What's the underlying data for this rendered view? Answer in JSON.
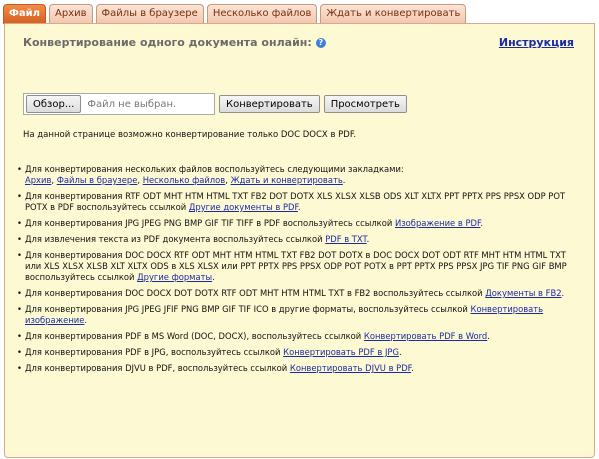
{
  "tabs": [
    "Файл",
    "Архив",
    "Файлы в браузере",
    "Несколько файлов",
    "Ждать и конвертировать"
  ],
  "header": {
    "title": "Конвертирование одного документа онлайн:",
    "help_icon": "?",
    "instruction_link": "Инструкция"
  },
  "file_input": {
    "browse_label": "Обзор...",
    "status": "Файл не выбран."
  },
  "buttons": {
    "convert": "Конвертировать",
    "view": "Просмотреть"
  },
  "note": "На данной странице возможно конвертирование только DOC DOCX в PDF.",
  "list": {
    "item1": {
      "text": "Для конвертирования нескольких файлов воспользуйтесь следующими закладками:",
      "links": [
        "Архив",
        "Файлы в браузере",
        "Несколько файлов",
        "Ждать и конвертировать"
      ],
      "sep": ", ",
      "end": "."
    },
    "item2": {
      "text": "Для конвертирования RTF ODT MHT HTM HTML TXT FB2 DOT DOTX XLS XLSX XLSB ODS XLT XLTX PPT PPTX PPS PPSX ODP POT POTX в PDF воспользуйтесь ссылкой ",
      "link": "Другие документы в PDF",
      "end": "."
    },
    "item3": {
      "text": "Для конвертирования JPG JPEG PNG BMP GIF TIF TIFF в PDF воспользуйтесь ссылкой ",
      "link": "Изображение в PDF",
      "end": "."
    },
    "item4": {
      "text": "Для извлечения текста из PDF документа воспользуйтесь ссылкой ",
      "link": "PDF в TXT",
      "end": "."
    },
    "item5": {
      "text": "Для конвертирования DOC DOCX RTF ODT MHT HTM HTML TXT FB2 DOT DOTX в DOC DOCX DOT ODT RTF MHT HTM HTML TXT или XLS XLSX XLSB XLT XLTX ODS в XLS XLSX или PPT PPTX PPS PPSX ODP POT POTX в PPT PPTX PPS PPSX JPG TIF PNG GIF BMP воспользуйтесь ссылкой ",
      "link": "Другие форматы",
      "end": "."
    },
    "item6": {
      "text": "Для конвертирования DOC DOCX DOT DOTX RTF ODT MHT HTM HTML TXT в FB2 воспользуйтесь ссылкой ",
      "link": "Документы в FB2",
      "end": "."
    },
    "item7": {
      "text": "Для конвертирования JPG JPEG JFIF PNG BMP GIF TIF ICO в другие форматы, воспользуйтесь ссылкой ",
      "link": "Конвертировать изображение",
      "end": "."
    },
    "item8": {
      "text": "Для конвертирования PDF в MS Word (DOC, DOCX), воспользуйтесь ссылкой ",
      "link": "Конвертировать PDF в Word",
      "end": "."
    },
    "item9": {
      "text": "Для конвертирования PDF в JPG, воспользуйтесь ссылкой ",
      "link": "Конвертировать PDF в JPG",
      "end": "."
    },
    "item10": {
      "text": "Для конвертирования DJVU в PDF, воспользуйтесь ссылкой ",
      "link": "Конвертировать DJVU в PDF",
      "end": "."
    }
  }
}
